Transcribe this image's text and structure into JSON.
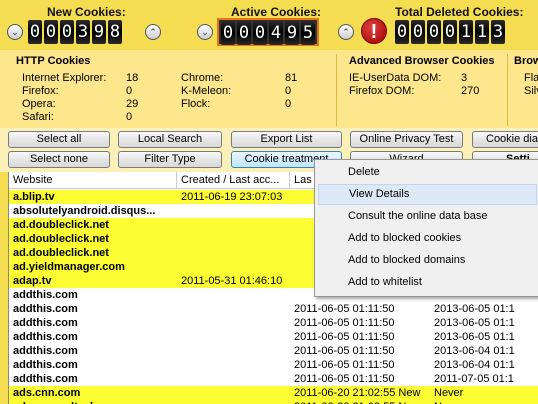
{
  "counters": {
    "new": {
      "title": "New Cookies:",
      "digits": [
        "0",
        "0",
        "0",
        "3",
        "9",
        "8"
      ]
    },
    "active": {
      "title": "Active Cookies:",
      "digits": [
        "0",
        "0",
        "0",
        "4",
        "9",
        "5"
      ]
    },
    "deleted": {
      "title": "Total Deleted Cookies:",
      "digits": [
        "0",
        "0",
        "0",
        "0",
        "1",
        "1",
        "3"
      ]
    },
    "down_glyph": "⌄",
    "up_glyph": "⌃",
    "warning_glyph": "!"
  },
  "http_cookies": {
    "title": "HTTP Cookies",
    "left": [
      {
        "label": "Internet Explorer:",
        "value": "18"
      },
      {
        "label": "Firefox:",
        "value": "0"
      },
      {
        "label": "Opera:",
        "value": "29"
      },
      {
        "label": "Safari:",
        "value": "0"
      }
    ],
    "right": [
      {
        "label": "Chrome:",
        "value": "81"
      },
      {
        "label": "K-Meleon:",
        "value": "0"
      },
      {
        "label": "Flock:",
        "value": "0"
      }
    ]
  },
  "advanced": {
    "title": "Advanced Browser Cookies",
    "rows": [
      {
        "label": "IE-UserData DOM:",
        "value": "3"
      },
      {
        "label": "Firefox DOM:",
        "value": "270"
      }
    ]
  },
  "third_panel": {
    "title": "Brow",
    "rows": [
      "Fla",
      "Silv"
    ]
  },
  "buttons": {
    "select_all": "Select all",
    "local_search": "Local Search",
    "export_list": "Export List",
    "privacy_test": "Online Privacy Test",
    "cookie_diag": "Cookie diag",
    "select_none": "Select none",
    "filter_type": "Filter Type",
    "cookie_treatment": "Cookie treatment",
    "wizard": "Wizard",
    "settings": "Setti"
  },
  "table": {
    "headers": [
      "Website",
      "Created / Last acc...",
      "Las",
      ""
    ],
    "rows": [
      {
        "site": "a.blip.tv",
        "created": "2011-06-19 23:07:03",
        "last": "",
        "extra": "",
        "hl": true
      },
      {
        "site": "absolutelyandroid.disqus...",
        "created": "",
        "last": "",
        "extra": "",
        "hl": false
      },
      {
        "site": "ad.doubleclick.net",
        "created": "",
        "last": "",
        "extra": "",
        "hl": true
      },
      {
        "site": "ad.doubleclick.net",
        "created": "",
        "last": "",
        "extra": "",
        "hl": true
      },
      {
        "site": "ad.doubleclick.net",
        "created": "",
        "last": "",
        "extra": "",
        "hl": true
      },
      {
        "site": "ad.yieldmanager.com",
        "created": "",
        "last": "",
        "extra": "",
        "hl": true
      },
      {
        "site": "adap.tv",
        "created": "2011-05-31 01:46:10",
        "last": "",
        "extra": "",
        "hl": true
      },
      {
        "site": "addthis.com",
        "created": "",
        "last": "",
        "extra": "",
        "hl": false
      },
      {
        "site": "addthis.com",
        "created": "",
        "last": "2011-06-05 01:11:50",
        "extra": "2013-06-05 01:1",
        "hl": false
      },
      {
        "site": "addthis.com",
        "created": "",
        "last": "2011-06-05 01:11:50",
        "extra": "2013-06-05 01:1",
        "hl": false
      },
      {
        "site": "addthis.com",
        "created": "",
        "last": "2011-06-05 01:11:50",
        "extra": "2013-06-05 01:1",
        "hl": false
      },
      {
        "site": "addthis.com",
        "created": "",
        "last": "2011-06-05 01:11:50",
        "extra": "2013-06-04 01:1",
        "hl": false
      },
      {
        "site": "addthis.com",
        "created": "",
        "last": "2011-06-05 01:11:50",
        "extra": "2013-06-04 01:1",
        "hl": false
      },
      {
        "site": "addthis.com",
        "created": "",
        "last": "2011-06-05 01:11:50",
        "extra": "2011-07-05 01:1",
        "hl": false
      },
      {
        "site": "ads.cnn.com",
        "created": "",
        "last": "2011-06-20 21:02:55 New",
        "extra": "Never",
        "hl": true
      },
      {
        "site": "adserver.adtechus.com",
        "created": "",
        "last": "2011-06-20 21:02:55 New",
        "extra": "Never",
        "hl": true
      }
    ]
  },
  "context_menu": {
    "items": [
      "Delete",
      "View Details",
      "Consult the online data base",
      "Add to blocked cookies",
      "Add to blocked domains",
      "Add to whitelist"
    ],
    "hovered_index": 1
  },
  "colors": {
    "header_bg": "#f5dd52",
    "panel_bg": "#fde68c",
    "highlight_row": "#fdfd33",
    "active_border": "#e8751a"
  }
}
